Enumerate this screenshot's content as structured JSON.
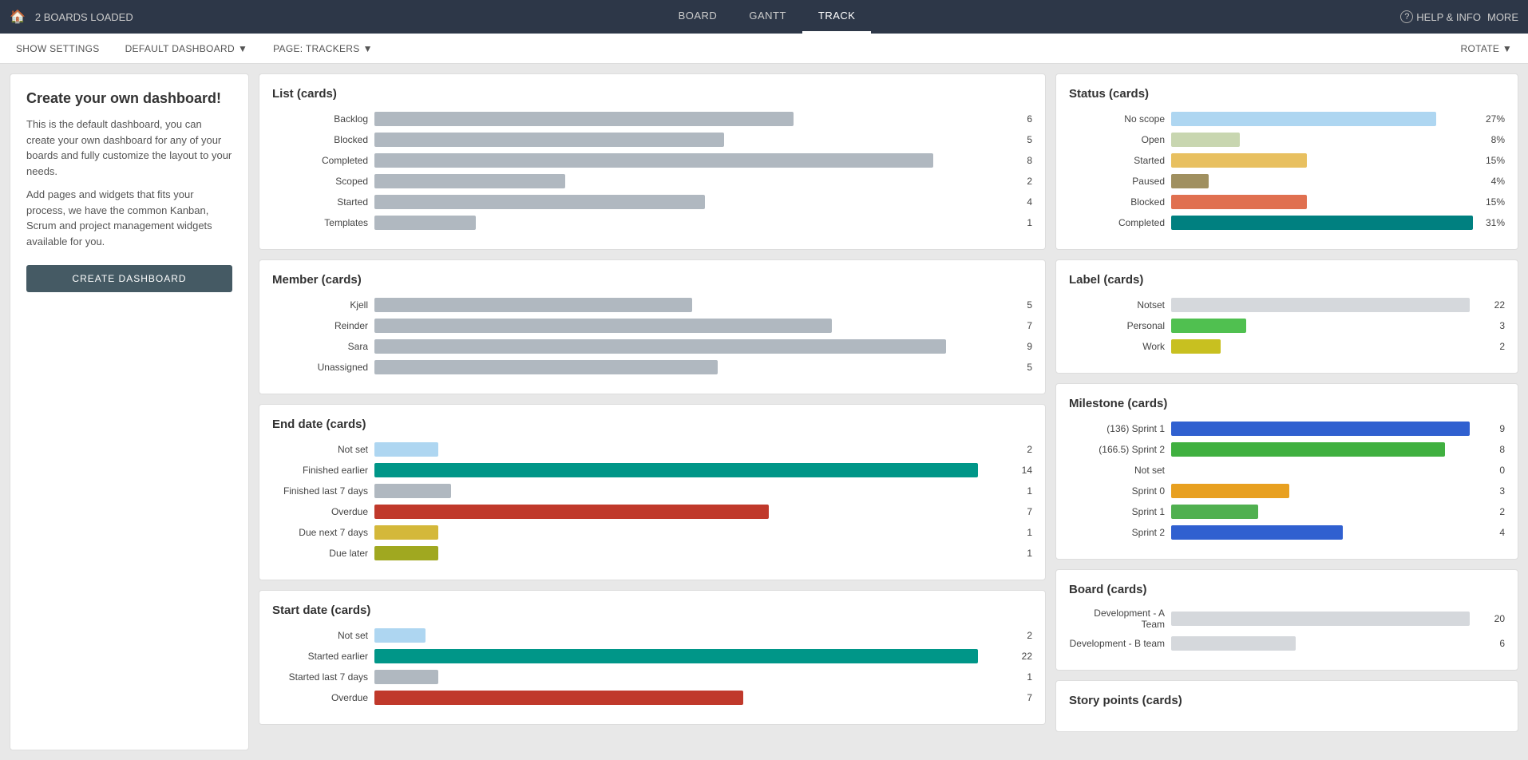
{
  "topNav": {
    "homeIcon": "🏠",
    "boardsLoaded": "2 BOARDS LOADED",
    "tabs": [
      {
        "label": "BOARD",
        "active": false
      },
      {
        "label": "GANTT",
        "active": false
      },
      {
        "label": "TRACK",
        "active": true
      }
    ],
    "helpLabel": "HELP & INFO",
    "moreLabel": "MORE",
    "helpIcon": "?"
  },
  "subNav": {
    "showSettings": "SHOW SETTINGS",
    "defaultDashboard": "DEFAULT DASHBOARD",
    "pageTrackers": "PAGE: TRACKERS",
    "rotateLabel": "ROTATE ▼"
  },
  "leftPanel": {
    "title": "Create your own dashboard!",
    "desc1": "This is the default dashboard, you can create your own dashboard for any of your boards and fully customize the layout to your needs.",
    "desc2": "Add pages and widgets that fits your process, we have the common Kanban, Scrum and project management widgets available for you.",
    "createButton": "CREATE DASHBOARD"
  },
  "listCards": {
    "title": "List (cards)",
    "maxVal": 9,
    "rows": [
      {
        "label": "Backlog",
        "value": 6,
        "pct": 66,
        "colorClass": "bar-gray"
      },
      {
        "label": "Blocked",
        "value": 5,
        "pct": 55,
        "colorClass": "bar-gray"
      },
      {
        "label": "Completed",
        "value": 8,
        "pct": 88,
        "colorClass": "bar-gray"
      },
      {
        "label": "Scoped",
        "value": 2,
        "pct": 35,
        "colorClass": "bar-gray"
      },
      {
        "label": "Started",
        "value": 4,
        "pct": 52,
        "colorClass": "bar-gray"
      },
      {
        "label": "Templates",
        "value": 1,
        "pct": 18,
        "colorClass": "bar-gray"
      }
    ]
  },
  "memberCards": {
    "title": "Member (cards)",
    "rows": [
      {
        "label": "Kjell",
        "value": 5,
        "pct": 50,
        "colorClass": "bar-gray"
      },
      {
        "label": "Reinder",
        "value": 7,
        "pct": 72,
        "colorClass": "bar-gray"
      },
      {
        "label": "Sara",
        "value": 9,
        "pct": 90,
        "colorClass": "bar-gray"
      },
      {
        "label": "Unassigned",
        "value": 5,
        "pct": 54,
        "colorClass": "bar-gray"
      }
    ]
  },
  "endDateCards": {
    "title": "End date (cards)",
    "rows": [
      {
        "label": "Not set",
        "value": 2,
        "pct": 10,
        "colorClass": "bar-lightblue"
      },
      {
        "label": "Finished earlier",
        "value": 14,
        "pct": 95,
        "colorClass": "bar-teal"
      },
      {
        "label": "Finished last 7 days",
        "value": 1,
        "pct": 12,
        "colorClass": "bar-gray"
      },
      {
        "label": "Overdue",
        "value": 7,
        "pct": 62,
        "colorClass": "bar-red"
      },
      {
        "label": "Due next 7 days",
        "value": 1,
        "pct": 10,
        "colorClass": "bar-yellow"
      },
      {
        "label": "Due later",
        "value": 1,
        "pct": 10,
        "colorClass": "bar-olive"
      }
    ]
  },
  "startDateCards": {
    "title": "Start date (cards)",
    "rows": [
      {
        "label": "Not set",
        "value": 2,
        "pct": 8,
        "colorClass": "bar-lightblue"
      },
      {
        "label": "Started earlier",
        "value": 22,
        "pct": 95,
        "colorClass": "bar-teal"
      },
      {
        "label": "Started last 7 days",
        "value": 1,
        "pct": 10,
        "colorClass": "bar-gray"
      },
      {
        "label": "Overdue",
        "value": 7,
        "pct": 62,
        "colorClass": "bar-red"
      }
    ]
  },
  "statusCards": {
    "title": "Status (cards)",
    "rows": [
      {
        "label": "No scope",
        "value": "27%",
        "pct": 86,
        "colorClass": "bar-status-noscope"
      },
      {
        "label": "Open",
        "value": "8%",
        "pct": 22,
        "colorClass": "bar-status-open"
      },
      {
        "label": "Started",
        "value": "15%",
        "pct": 44,
        "colorClass": "bar-status-started"
      },
      {
        "label": "Paused",
        "value": "4%",
        "pct": 12,
        "colorClass": "bar-status-paused"
      },
      {
        "label": "Blocked",
        "value": "15%",
        "pct": 44,
        "colorClass": "bar-status-blocked"
      },
      {
        "label": "Completed",
        "value": "31%",
        "pct": 98,
        "colorClass": "bar-status-completed"
      }
    ]
  },
  "labelCards": {
    "title": "Label (cards)",
    "rows": [
      {
        "label": "Notset",
        "value": 22,
        "pct": 96,
        "colorClass": "bar-label-notset"
      },
      {
        "label": "Personal",
        "value": 3,
        "pct": 22,
        "colorClass": "bar-label-personal"
      },
      {
        "label": "Work",
        "value": 2,
        "pct": 15,
        "colorClass": "bar-label-work"
      }
    ]
  },
  "milestoneCards": {
    "title": "Milestone (cards)",
    "rows": [
      {
        "label": "(136) Sprint 1",
        "value": 9,
        "pct": 96,
        "colorClass": "bar-ms-sprint1"
      },
      {
        "label": "(166.5) Sprint 2",
        "value": 8,
        "pct": 88,
        "colorClass": "bar-ms-sprint2-166"
      },
      {
        "label": "Not set",
        "value": 0,
        "pct": 0,
        "colorClass": "bar-ms-notset"
      },
      {
        "label": "Sprint 0",
        "value": 3,
        "pct": 38,
        "colorClass": "bar-ms-sprint0"
      },
      {
        "label": "Sprint 1",
        "value": 2,
        "pct": 28,
        "colorClass": "bar-ms-sprint1b"
      },
      {
        "label": "Sprint 2",
        "value": 4,
        "pct": 55,
        "colorClass": "bar-ms-sprint2b"
      }
    ]
  },
  "boardCards": {
    "title": "Board (cards)",
    "rows": [
      {
        "label": "Development - A Team",
        "value": 20,
        "pct": 96,
        "colorClass": "bar-board-a"
      },
      {
        "label": "Development - B team",
        "value": 6,
        "pct": 40,
        "colorClass": "bar-board-b"
      }
    ]
  },
  "storyPoints": {
    "title": "Story points (cards)"
  }
}
